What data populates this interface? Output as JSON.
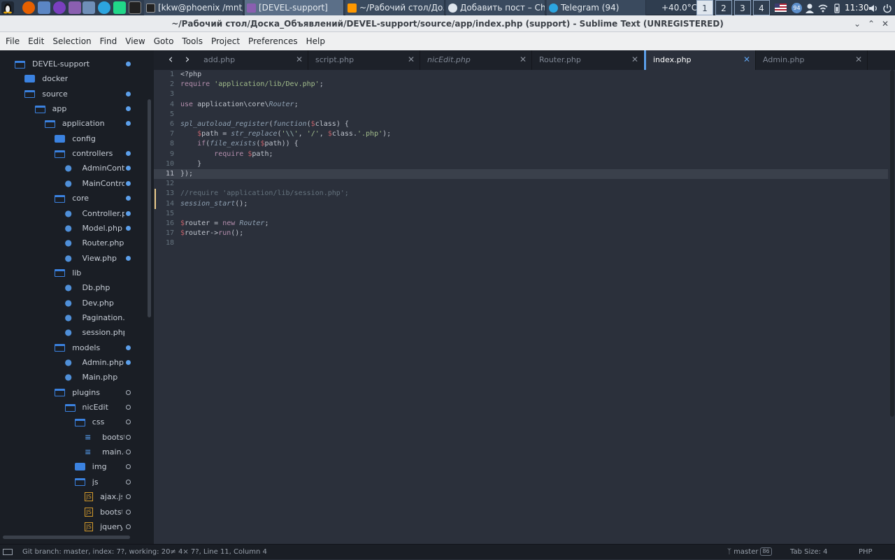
{
  "taskbar": {
    "windows": [
      {
        "label": "[kkw@phoenix /mnt/...",
        "active": false
      },
      {
        "label": "[DEVEL-support]",
        "active": true
      },
      {
        "label": "~/Рабочий стол/До...",
        "active": false
      },
      {
        "label": "Добавить пост – Ch...",
        "active": false
      },
      {
        "label": "Telegram (94)",
        "active": false
      }
    ],
    "temperature": "+40.0°C",
    "workspaces": [
      "1",
      "2",
      "3",
      "4"
    ],
    "active_workspace": "1",
    "tray_badge": "94",
    "clock": "11:30"
  },
  "window": {
    "title": "~/Рабочий стол/Доска_Объявлений/DEVEL-support/source/app/index.php (support) - Sublime Text (UNREGISTERED)"
  },
  "menu": [
    "File",
    "Edit",
    "Selection",
    "Find",
    "View",
    "Goto",
    "Tools",
    "Project",
    "Preferences",
    "Help"
  ],
  "sidebar": {
    "items": [
      {
        "label": "DEVEL-support",
        "indent": 0,
        "type": "folder-open",
        "dot": "mod"
      },
      {
        "label": "docker",
        "indent": 1,
        "type": "folder",
        "dot": ""
      },
      {
        "label": "source",
        "indent": 1,
        "type": "folder-open",
        "dot": "mod"
      },
      {
        "label": "app",
        "indent": 2,
        "type": "folder-open",
        "dot": "mod"
      },
      {
        "label": "application",
        "indent": 3,
        "type": "folder-open",
        "dot": "mod"
      },
      {
        "label": "config",
        "indent": 4,
        "type": "folder",
        "dot": ""
      },
      {
        "label": "controllers",
        "indent": 4,
        "type": "folder-open",
        "dot": "mod"
      },
      {
        "label": "AdminController.php",
        "indent": 5,
        "type": "php",
        "dot": "mod"
      },
      {
        "label": "MainController.php",
        "indent": 5,
        "type": "php",
        "dot": "mod"
      },
      {
        "label": "core",
        "indent": 4,
        "type": "folder-open",
        "dot": "mod"
      },
      {
        "label": "Controller.php",
        "indent": 5,
        "type": "php",
        "dot": "mod"
      },
      {
        "label": "Model.php",
        "indent": 5,
        "type": "php",
        "dot": "mod"
      },
      {
        "label": "Router.php",
        "indent": 5,
        "type": "php",
        "dot": ""
      },
      {
        "label": "View.php",
        "indent": 5,
        "type": "php",
        "dot": "mod"
      },
      {
        "label": "lib",
        "indent": 4,
        "type": "folder-open",
        "dot": ""
      },
      {
        "label": "Db.php",
        "indent": 5,
        "type": "php",
        "dot": ""
      },
      {
        "label": "Dev.php",
        "indent": 5,
        "type": "php",
        "dot": ""
      },
      {
        "label": "Pagination.php",
        "indent": 5,
        "type": "php",
        "dot": ""
      },
      {
        "label": "session.php",
        "indent": 5,
        "type": "php",
        "dot": ""
      },
      {
        "label": "models",
        "indent": 4,
        "type": "folder-open",
        "dot": "mod"
      },
      {
        "label": "Admin.php",
        "indent": 5,
        "type": "php",
        "dot": "mod"
      },
      {
        "label": "Main.php",
        "indent": 5,
        "type": "php",
        "dot": ""
      },
      {
        "label": "plugins",
        "indent": 4,
        "type": "folder-open",
        "dot": "new"
      },
      {
        "label": "nicEdit",
        "indent": 5,
        "type": "folder-open",
        "dot": "new"
      },
      {
        "label": "css",
        "indent": 6,
        "type": "folder-open",
        "dot": "new"
      },
      {
        "label": "bootstrap.css",
        "indent": 7,
        "type": "css",
        "dot": "new"
      },
      {
        "label": "main.css",
        "indent": 7,
        "type": "css",
        "dot": "new"
      },
      {
        "label": "img",
        "indent": 6,
        "type": "folder",
        "dot": "new"
      },
      {
        "label": "js",
        "indent": 6,
        "type": "folder-open",
        "dot": "new"
      },
      {
        "label": "ajax.js",
        "indent": 7,
        "type": "js",
        "dot": "new"
      },
      {
        "label": "bootstrap.js",
        "indent": 7,
        "type": "js",
        "dot": "new"
      },
      {
        "label": "jquery.min.js",
        "indent": 7,
        "type": "js",
        "dot": "new"
      }
    ]
  },
  "tabs": [
    {
      "label": "add.php",
      "active": false,
      "italic": false
    },
    {
      "label": "script.php",
      "active": false,
      "italic": false
    },
    {
      "label": "nicEdit.php",
      "active": false,
      "italic": true
    },
    {
      "label": "Router.php",
      "active": false,
      "italic": false
    },
    {
      "label": "index.php",
      "active": true,
      "italic": false
    },
    {
      "label": "Admin.php",
      "active": false,
      "italic": false
    }
  ],
  "editor": {
    "current_line": 11,
    "modified_line": 14,
    "lines": [
      [
        [
          "tag",
          "<?php"
        ]
      ],
      [
        [
          "kw",
          "require"
        ],
        [
          "punc",
          " "
        ],
        [
          "str",
          "'application/lib/Dev.php'"
        ],
        [
          "punc",
          ";"
        ]
      ],
      [],
      [
        [
          "kw",
          "use"
        ],
        [
          "punc",
          " application\\core\\"
        ],
        [
          "cls",
          "Router"
        ],
        [
          "punc",
          ";"
        ]
      ],
      [],
      [
        [
          "fn",
          "spl_autoload_register"
        ],
        [
          "punc",
          "("
        ],
        [
          "fn",
          "function"
        ],
        [
          "punc",
          "("
        ],
        [
          "dollar",
          "$"
        ],
        [
          "var",
          "class"
        ],
        [
          "punc",
          ") {"
        ]
      ],
      [
        [
          "punc",
          "    "
        ],
        [
          "dollar",
          "$"
        ],
        [
          "var",
          "path"
        ],
        [
          "op",
          " = "
        ],
        [
          "fn",
          "str_replace"
        ],
        [
          "punc",
          "("
        ],
        [
          "str",
          "'"
        ],
        [
          "esc",
          "\\\\"
        ],
        [
          "str",
          "'"
        ],
        [
          "punc",
          ", "
        ],
        [
          "str",
          "'/'"
        ],
        [
          "punc",
          ", "
        ],
        [
          "dollar",
          "$"
        ],
        [
          "var",
          "class"
        ],
        [
          "punc",
          "."
        ],
        [
          "str",
          "'.php'"
        ],
        [
          "punc",
          ");"
        ]
      ],
      [
        [
          "punc",
          "    "
        ],
        [
          "kw",
          "if"
        ],
        [
          "punc",
          "("
        ],
        [
          "fn",
          "file_exists"
        ],
        [
          "punc",
          "("
        ],
        [
          "dollar",
          "$"
        ],
        [
          "var",
          "path"
        ],
        [
          "punc",
          ")) {"
        ]
      ],
      [
        [
          "punc",
          "        "
        ],
        [
          "kw",
          "require"
        ],
        [
          "punc",
          " "
        ],
        [
          "dollar",
          "$"
        ],
        [
          "var",
          "path"
        ],
        [
          "punc",
          ";"
        ]
      ],
      [
        [
          "punc",
          "    }"
        ]
      ],
      [
        [
          "punc",
          "});"
        ]
      ],
      [],
      [
        [
          "cmt",
          "//require 'application/lib/session.php';"
        ]
      ],
      [
        [
          "fn",
          "session_start"
        ],
        [
          "punc",
          "();"
        ]
      ],
      [],
      [
        [
          "dollar",
          "$"
        ],
        [
          "var",
          "router"
        ],
        [
          "op",
          " = "
        ],
        [
          "kw",
          "new"
        ],
        [
          "punc",
          " "
        ],
        [
          "cls",
          "Router"
        ],
        [
          "punc",
          ";"
        ]
      ],
      [
        [
          "dollar",
          "$"
        ],
        [
          "var",
          "router"
        ],
        [
          "op",
          "->"
        ],
        [
          "kw",
          "run"
        ],
        [
          "punc",
          "();"
        ]
      ],
      []
    ]
  },
  "status": {
    "git": "Git branch: master, index: 7?, working: 20≠ 4× 7?, Line 11, Column 4",
    "branch": "master",
    "branch_badge": "86",
    "tab_size": "Tab Size: 4",
    "syntax": "PHP"
  },
  "colors": {
    "accent": "#5c9fea",
    "editor_bg": "#2b303b",
    "sidebar_bg": "#1a1e25",
    "modified_marker": "#ebcb8b"
  }
}
